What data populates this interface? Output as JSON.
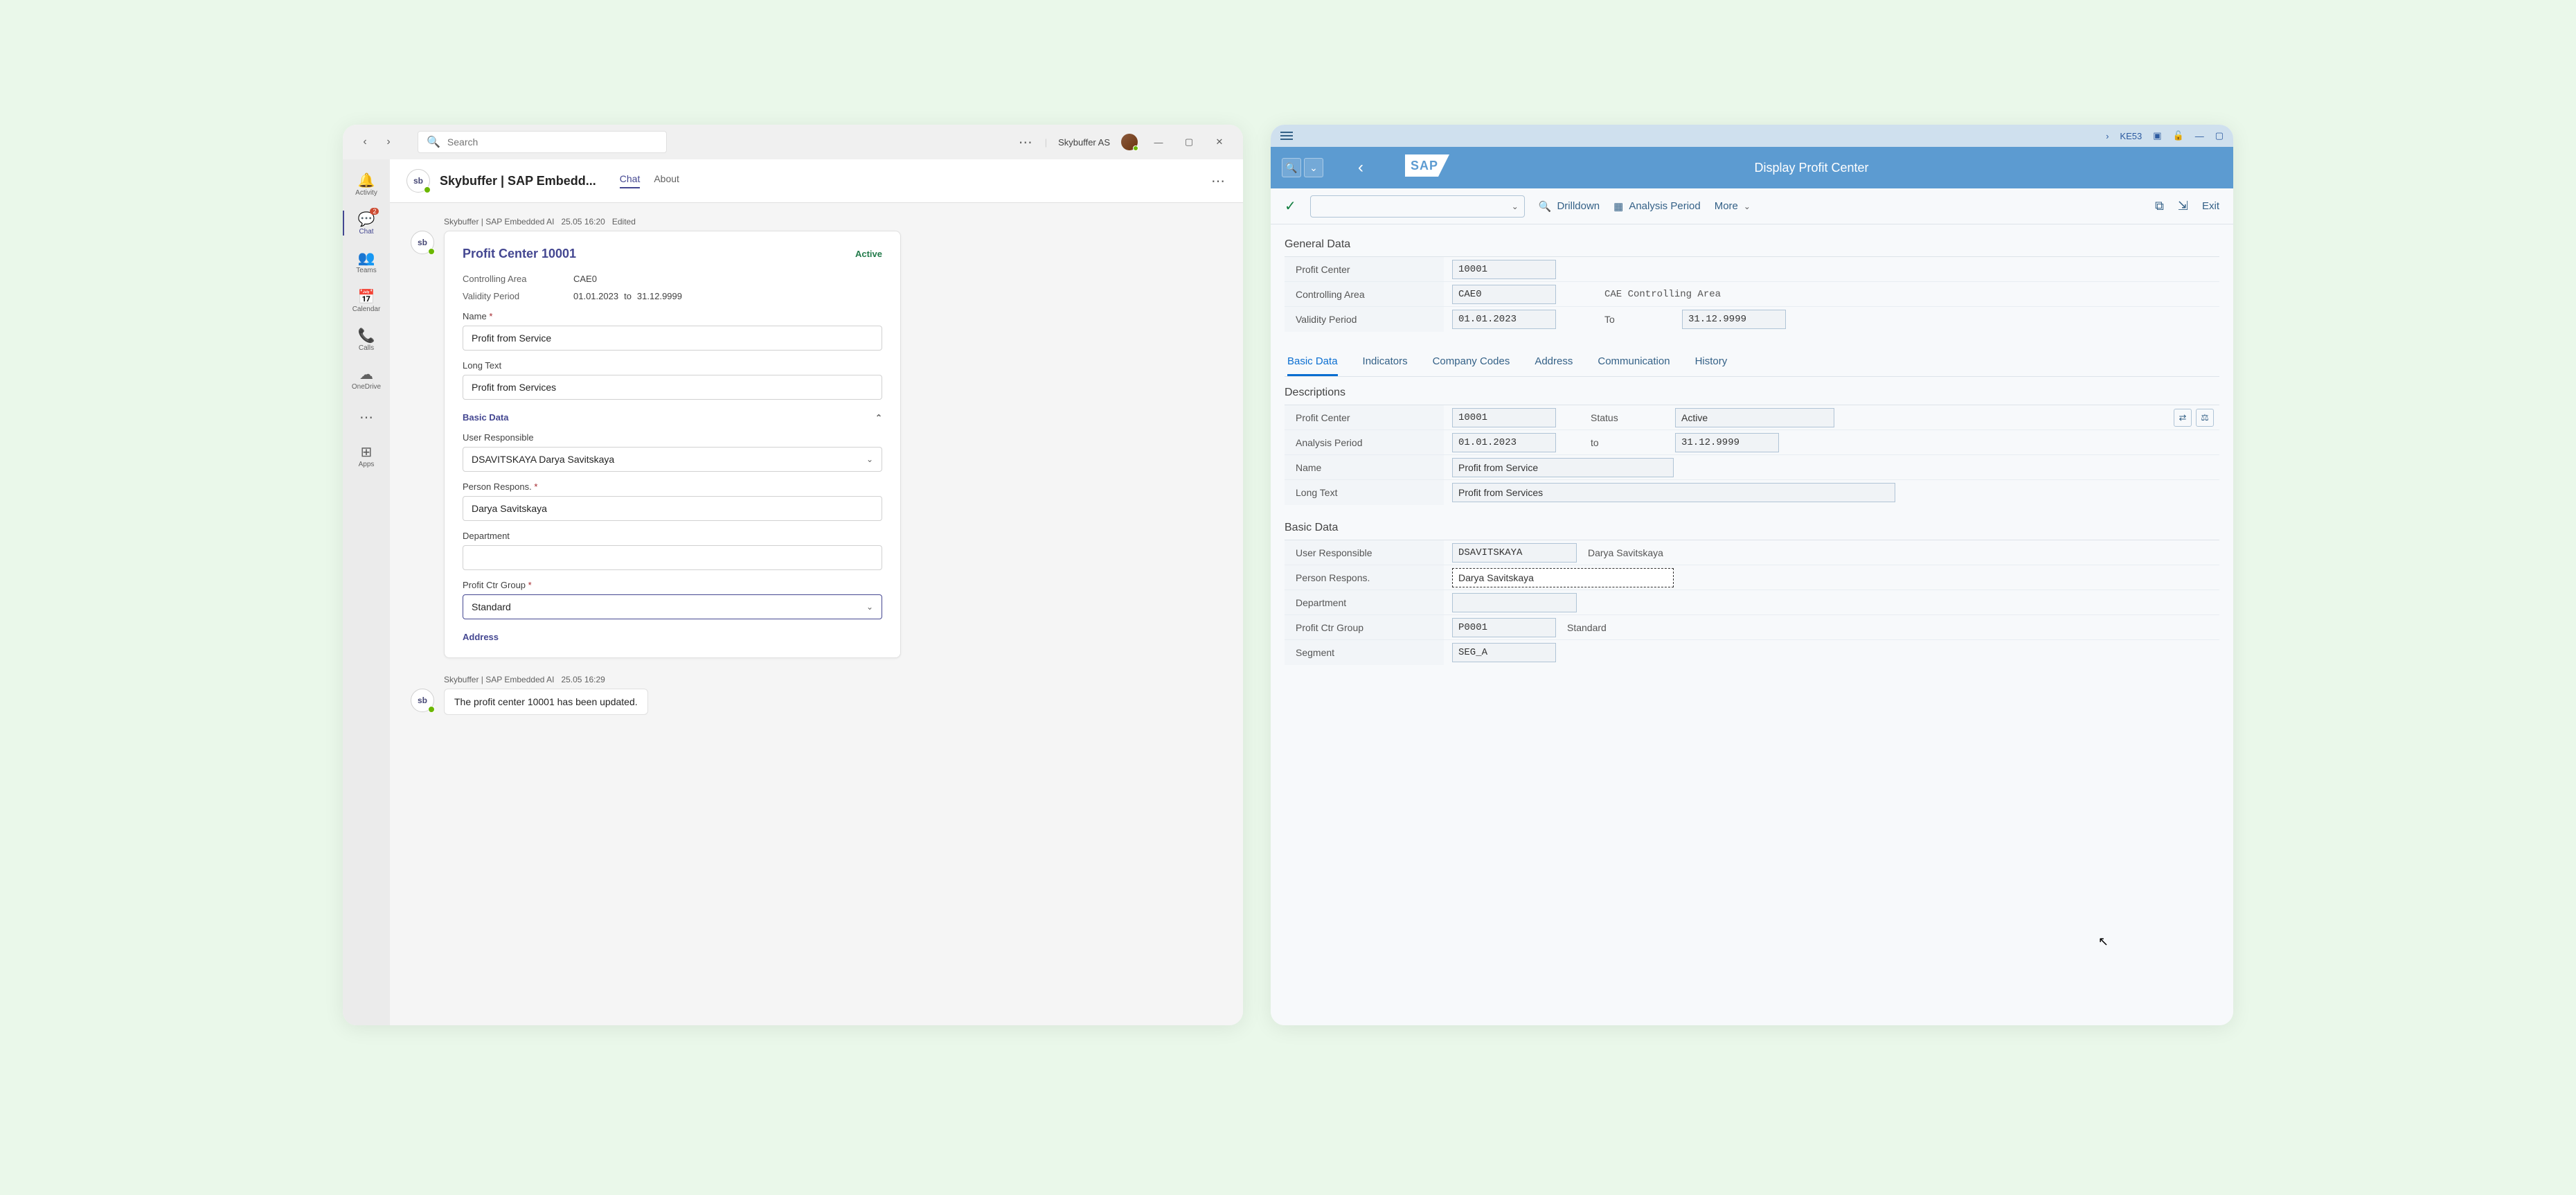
{
  "teams": {
    "search_placeholder": "Search",
    "org_name": "Skybuffer AS",
    "rail": [
      {
        "label": "Activity"
      },
      {
        "label": "Chat",
        "badge": "2"
      },
      {
        "label": "Teams"
      },
      {
        "label": "Calendar"
      },
      {
        "label": "Calls"
      },
      {
        "label": "OneDrive"
      },
      {
        "label": "Apps"
      }
    ],
    "chat_header": {
      "title": "Skybuffer | SAP Embedd...",
      "tabs": [
        "Chat",
        "About"
      ]
    },
    "msg1": {
      "sender": "Skybuffer | SAP Embedded AI",
      "time": "25.05 16:20",
      "edited": "Edited"
    },
    "card": {
      "title": "Profit Center 10001",
      "status": "Active",
      "controlling_area_lbl": "Controlling Area",
      "controlling_area": "CAE0",
      "validity_lbl": "Validity Period",
      "validity_from": "01.01.2023",
      "validity_to_word": "to",
      "validity_to": "31.12.9999",
      "name_lbl": "Name",
      "name_val": "Profit from Service",
      "long_text_lbl": "Long Text",
      "long_text_val": "Profit from Services",
      "basic_data_hdr": "Basic Data",
      "user_resp_lbl": "User Responsible",
      "user_resp_val": "DSAVITSKAYA Darya Savitskaya",
      "person_resp_lbl": "Person Respons.",
      "person_resp_val": "Darya Savitskaya",
      "dept_lbl": "Department",
      "dept_val": "",
      "pcg_lbl": "Profit Ctr Group",
      "pcg_val": "Standard",
      "address_hdr": "Address"
    },
    "msg2": {
      "sender": "Skybuffer | SAP Embedded AI",
      "time": "25.05 16:29",
      "text": "The profit center 10001 has been updated."
    }
  },
  "sap": {
    "tcode": "KE53",
    "page_title": "Display Profit Center",
    "toolbar": {
      "drilldown": "Drilldown",
      "analysis_period": "Analysis Period",
      "more": "More",
      "exit": "Exit"
    },
    "general": {
      "title": "General Data",
      "profit_center_lbl": "Profit Center",
      "profit_center": "10001",
      "controlling_area_lbl": "Controlling Area",
      "controlling_area": "CAE0",
      "controlling_area_desc": "CAE Controlling Area",
      "validity_lbl": "Validity Period",
      "validity_from": "01.01.2023",
      "validity_to_lbl": "To",
      "validity_to": "31.12.9999"
    },
    "tabs": [
      "Basic Data",
      "Indicators",
      "Company Codes",
      "Address",
      "Communication",
      "History"
    ],
    "descriptions": {
      "title": "Descriptions",
      "profit_center_lbl": "Profit Center",
      "profit_center": "10001",
      "status_lbl": "Status",
      "status": "Active",
      "analysis_period_lbl": "Analysis Period",
      "analysis_from": "01.01.2023",
      "analysis_to_lbl": "to",
      "analysis_to": "31.12.9999",
      "name_lbl": "Name",
      "name": "Profit from Service",
      "long_text_lbl": "Long Text",
      "long_text": "Profit from Services"
    },
    "basic": {
      "title": "Basic Data",
      "user_resp_lbl": "User Responsible",
      "user_resp": "DSAVITSKAYA",
      "user_resp_name": "Darya Savitskaya",
      "person_resp_lbl": "Person Respons.",
      "person_resp": "Darya Savitskaya",
      "dept_lbl": "Department",
      "dept": "",
      "pcg_lbl": "Profit Ctr Group",
      "pcg": "P0001",
      "pcg_desc": "Standard",
      "segment_lbl": "Segment",
      "segment": "SEG_A"
    }
  }
}
